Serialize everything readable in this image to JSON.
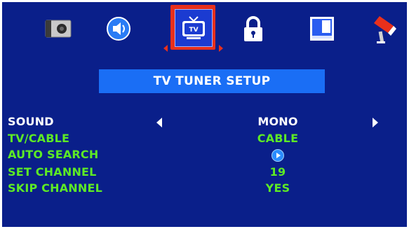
{
  "icons": [
    {
      "name": "camera-icon"
    },
    {
      "name": "speaker-icon"
    },
    {
      "name": "tv-icon",
      "label": "TV",
      "selected": true
    },
    {
      "name": "lock-icon"
    },
    {
      "name": "image-icon"
    },
    {
      "name": "tools-icon"
    }
  ],
  "title": "TV TUNER SETUP",
  "settings": [
    {
      "label": "SOUND",
      "value": "MONO",
      "selected": true
    },
    {
      "label": "TV/CABLE",
      "value": "CABLE"
    },
    {
      "label": "AUTO SEARCH",
      "value": "",
      "action": "play-icon"
    },
    {
      "label": "SET CHANNEL",
      "value": "19"
    },
    {
      "label": "SKIP CHANNEL",
      "value": "YES"
    }
  ],
  "colors": {
    "background": "#0a1f8a",
    "title_bar": "#1a6ef5",
    "selected_text": "#ffffff",
    "normal_text": "#5dea25",
    "highlight": "#e8301c"
  }
}
